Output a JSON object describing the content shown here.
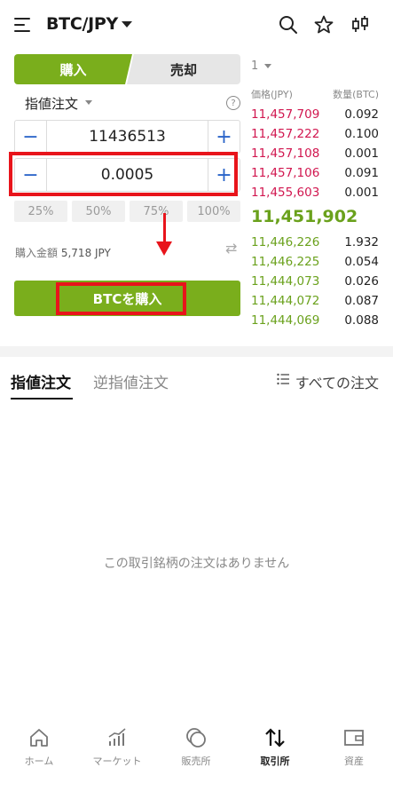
{
  "header": {
    "pair": "BTC/JPY",
    "icons": [
      "menu-icon",
      "search-icon",
      "star-icon",
      "candlestick-icon"
    ]
  },
  "trade": {
    "tab_buy": "購入",
    "tab_sell": "売却",
    "order_type": "指値注文",
    "help": "?",
    "price_value": "11436513",
    "amount_value": "0.0005",
    "minus": "−",
    "plus": "+",
    "percents": [
      "25%",
      "50%",
      "75%",
      "100%"
    ],
    "purchase_amount_label": "購入金額",
    "purchase_amount_value": "5,718 JPY",
    "buy_button": "BTCを購入"
  },
  "orderbook": {
    "qty_selector": "1",
    "col_price": "価格(JPY)",
    "col_qty": "数量(BTC)",
    "asks": [
      {
        "price": "11,457,709",
        "qty": "0.092"
      },
      {
        "price": "11,457,222",
        "qty": "0.100"
      },
      {
        "price": "11,457,108",
        "qty": "0.001"
      },
      {
        "price": "11,457,106",
        "qty": "0.091"
      },
      {
        "price": "11,455,603",
        "qty": "0.001"
      }
    ],
    "mid_price": "11,451,902",
    "bids": [
      {
        "price": "11,446,226",
        "qty": "1.932"
      },
      {
        "price": "11,446,225",
        "qty": "0.054"
      },
      {
        "price": "11,444,073",
        "qty": "0.026"
      },
      {
        "price": "11,444,072",
        "qty": "0.087"
      },
      {
        "price": "11,444,069",
        "qty": "0.088"
      }
    ]
  },
  "orders": {
    "tab_limit": "指値注文",
    "tab_stop": "逆指値注文",
    "all_orders": "すべての注文",
    "empty_message": "この取引銘柄の注文はありません"
  },
  "bottom_nav": [
    {
      "label": "ホーム",
      "icon": "home-icon"
    },
    {
      "label": "マーケット",
      "icon": "market-chart-icon"
    },
    {
      "label": "販売所",
      "icon": "coins-icon"
    },
    {
      "label": "取引所",
      "icon": "exchange-arrows-icon",
      "active": true
    },
    {
      "label": "資産",
      "icon": "wallet-icon"
    }
  ],
  "colors": {
    "accent_green": "#7aae1c",
    "ask_red": "#d1164f",
    "bid_green": "#6aa11c",
    "annotation_red": "#e8141b",
    "stepper_blue": "#2a64c9"
  }
}
